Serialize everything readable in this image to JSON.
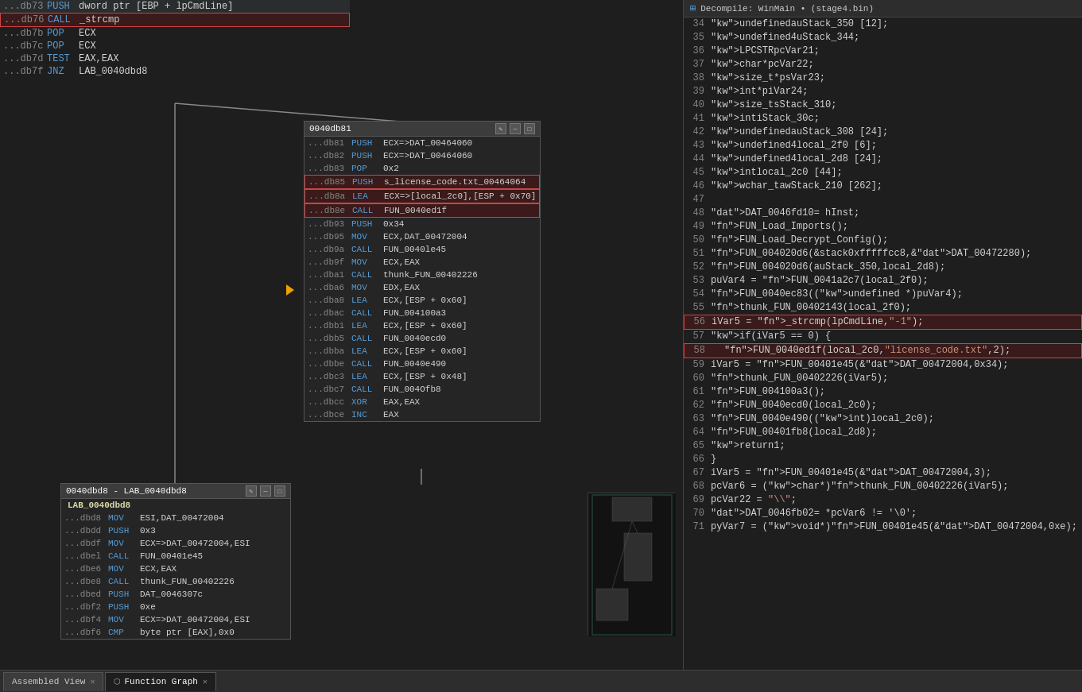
{
  "header": {
    "left_title": "Function Graph",
    "right_title": "Decompile: WinMain • (stage4.bin)"
  },
  "tabs": [
    {
      "label": "Assembled View",
      "active": false,
      "icon": "asm"
    },
    {
      "label": "Function Graph",
      "active": true,
      "icon": "graph"
    }
  ],
  "top_asm_lines": [
    {
      "addr": "...db73",
      "mnemonic": "PUSH",
      "operands": "dword ptr [EBP + lpCmdLine]"
    },
    {
      "addr": "...db76",
      "mnemonic": "CALL",
      "operands": "_strcmp",
      "highlight": "red"
    },
    {
      "addr": "...db7b",
      "mnemonic": "POP",
      "operands": "ECX"
    },
    {
      "addr": "...db7c",
      "mnemonic": "POP",
      "operands": "ECX"
    },
    {
      "addr": "...db7d",
      "mnemonic": "TEST",
      "operands": "EAX,EAX"
    },
    {
      "addr": "...db7f",
      "mnemonic": "JNZ",
      "operands": "LAB_0040dbd8"
    }
  ],
  "block1": {
    "title": "0040db81",
    "lines": [
      {
        "addr": "...db81",
        "mnemonic": "PUSH",
        "operands": "ECX=>DAT_00464060"
      },
      {
        "addr": "...db82",
        "mnemonic": "PUSH",
        "operands": "ECX=>DAT_00464060"
      },
      {
        "addr": "...db83",
        "mnemonic": "POP",
        "operands": "0x2"
      },
      {
        "addr": "...db85",
        "mnemonic": "PUSH",
        "operands": "s_license_code.txt_00464064",
        "highlight": "red"
      },
      {
        "addr": "...db8a",
        "mnemonic": "LEA",
        "operands": "ECX=>[local_2c0],[ESP + 0x70]",
        "highlight": "red"
      },
      {
        "addr": "...db8e",
        "mnemonic": "CALL",
        "operands": "FUN_0040ed1f",
        "highlight": "red"
      },
      {
        "addr": "...db93",
        "mnemonic": "PUSH",
        "operands": "0x34"
      },
      {
        "addr": "...db95",
        "mnemonic": "MOV",
        "operands": "ECX,DAT_00472004"
      },
      {
        "addr": "...db9a",
        "mnemonic": "CALL",
        "operands": "FUN_0040le45"
      },
      {
        "addr": "...db9f",
        "mnemonic": "MOV",
        "operands": "ECX,EAX"
      },
      {
        "addr": "...dba1",
        "mnemonic": "CALL",
        "operands": "thunk_FUN_00402226"
      },
      {
        "addr": "...dba6",
        "mnemonic": "MOV",
        "operands": "EDX,EAX"
      },
      {
        "addr": "...dba8",
        "mnemonic": "LEA",
        "operands": "ECX,[ESP + 0x60]"
      },
      {
        "addr": "...dbac",
        "mnemonic": "CALL",
        "operands": "FUN_004100a3"
      },
      {
        "addr": "...dbb1",
        "mnemonic": "LEA",
        "operands": "ECX,[ESP + 0x60]"
      },
      {
        "addr": "...dbb5",
        "mnemonic": "CALL",
        "operands": "FUN_0040ecd0"
      },
      {
        "addr": "...dbba",
        "mnemonic": "LEA",
        "operands": "ECX,[ESP + 0x60]"
      },
      {
        "addr": "...dbbe",
        "mnemonic": "CALL",
        "operands": "FUN_0040e490"
      },
      {
        "addr": "...dbc3",
        "mnemonic": "LEA",
        "operands": "ECX,[ESP + 0x48]"
      },
      {
        "addr": "...dbc7",
        "mnemonic": "CALL",
        "operands": "FUN_004Ofb8"
      },
      {
        "addr": "...dbcc",
        "mnemonic": "XOR",
        "operands": "EAX,EAX"
      },
      {
        "addr": "...dbce",
        "mnemonic": "INC",
        "operands": "EAX"
      }
    ]
  },
  "block2": {
    "title": "0040dbd8 - LAB_0040dbd8",
    "lines": [
      {
        "addr": "",
        "mnemonic": "",
        "operands": "LAB_0040dbd8"
      },
      {
        "addr": "...dbd8",
        "mnemonic": "MOV",
        "operands": "ESI,DAT_00472004"
      },
      {
        "addr": "...dbdd",
        "mnemonic": "PUSH",
        "operands": "0x3"
      },
      {
        "addr": "...dbdf",
        "mnemonic": "MOV",
        "operands": "ECX=>DAT_00472004,ESI"
      },
      {
        "addr": "...dbel",
        "mnemonic": "CALL",
        "operands": "FUN_00401e45"
      },
      {
        "addr": "...dbe6",
        "mnemonic": "MOV",
        "operands": "ECX,EAX"
      },
      {
        "addr": "...dbe8",
        "mnemonic": "CALL",
        "operands": "thunk_FUN_00402226"
      },
      {
        "addr": "...dbed",
        "mnemonic": "PUSH",
        "operands": "DAT_0046307c"
      },
      {
        "addr": "...dbf2",
        "mnemonic": "PUSH",
        "operands": "0xe"
      },
      {
        "addr": "...dbf4",
        "mnemonic": "MOV",
        "operands": "ECX=>DAT_00472004,ESI"
      },
      {
        "addr": "...dbf6",
        "mnemonic": "CMP",
        "operands": "byte ptr [EAX],0x0"
      }
    ]
  },
  "decompiler": {
    "title": "Decompile: WinMain • (stage4.bin)",
    "lines": [
      {
        "num": "34",
        "code": "undefined auStack_350 [12];"
      },
      {
        "num": "35",
        "code": "undefined4 uStack_344;"
      },
      {
        "num": "36",
        "code": "LPCSTR pcVar21;"
      },
      {
        "num": "37",
        "code": "char *pcVar22;"
      },
      {
        "num": "38",
        "code": "size_t *psVar23;"
      },
      {
        "num": "39",
        "code": "int *piVar24;"
      },
      {
        "num": "40",
        "code": "size_t sStack_310;"
      },
      {
        "num": "41",
        "code": "int iStack_30c;"
      },
      {
        "num": "42",
        "code": "undefined auStack_308 [24];"
      },
      {
        "num": "43",
        "code": "undefined4 local_2f0 [6];"
      },
      {
        "num": "44",
        "code": "undefined4 local_2d8 [24];"
      },
      {
        "num": "45",
        "code": "int local_2c0 [44];"
      },
      {
        "num": "46",
        "code": "wchar_t awStack_210 [262];"
      },
      {
        "num": "47",
        "code": ""
      },
      {
        "num": "48",
        "code": "DAT_0046fd10 = hInst;",
        "type": "dat"
      },
      {
        "num": "49",
        "code": "FUN_Load_Imports();",
        "type": "fn"
      },
      {
        "num": "50",
        "code": "FUN_Load_Decrypt_Config();",
        "type": "fn"
      },
      {
        "num": "51",
        "code": "FUN_004020d6(&stack0xfffffcc8,&DAT_00472280);",
        "type": "fn"
      },
      {
        "num": "52",
        "code": "FUN_004020d6(auStack_350,local_2d8);",
        "type": "fn"
      },
      {
        "num": "53",
        "code": "puVar4 = FUN_0041a2c7(local_2f0);",
        "type": "fn"
      },
      {
        "num": "54",
        "code": "FUN_0040ec83((undefined *)puVar4);",
        "type": "fn"
      },
      {
        "num": "55",
        "code": "thunk_FUN_00402143(local_2f0);",
        "type": "fn"
      },
      {
        "num": "56",
        "code": "iVar5 = _strcmp(lpCmdLine,\"-1\");",
        "highlight": "red"
      },
      {
        "num": "57",
        "code": "if (iVar5 == 0) {"
      },
      {
        "num": "58",
        "code": "  FUN_0040ed1f(local_2c0,\"license_code.txt\",2);",
        "highlight": "red_inner"
      },
      {
        "num": "59",
        "code": "  iVar5 = FUN_00401e45(&DAT_00472004,0x34);",
        "type": "fn"
      },
      {
        "num": "60",
        "code": "  thunk_FUN_00402226(iVar5);",
        "type": "fn"
      },
      {
        "num": "61",
        "code": "  FUN_004100a3();",
        "type": "fn"
      },
      {
        "num": "62",
        "code": "  FUN_0040ecd0(local_2c0);",
        "type": "fn"
      },
      {
        "num": "63",
        "code": "  FUN_0040e490((int)local_2c0);",
        "type": "fn"
      },
      {
        "num": "64",
        "code": "  FUN_00401fb8(local_2d8);",
        "type": "fn"
      },
      {
        "num": "65",
        "code": "  return 1;"
      },
      {
        "num": "66",
        "code": "}"
      },
      {
        "num": "67",
        "code": "iVar5 = FUN_00401e45(&DAT_00472004,3);",
        "type": "fn"
      },
      {
        "num": "68",
        "code": "pcVar6 = (char *)thunk_FUN_00402226(iVar5);",
        "type": "fn"
      },
      {
        "num": "69",
        "code": "pcVar22 = \"\\\\\";"
      },
      {
        "num": "70",
        "code": "DAT_0046fb02 = *pcVar6 != '\\0';",
        "type": "dat"
      },
      {
        "num": "71",
        "code": "pyVar7 = (void *)FUN_00401e45(&DAT_00472004,0xe);",
        "type": "fn"
      }
    ]
  }
}
